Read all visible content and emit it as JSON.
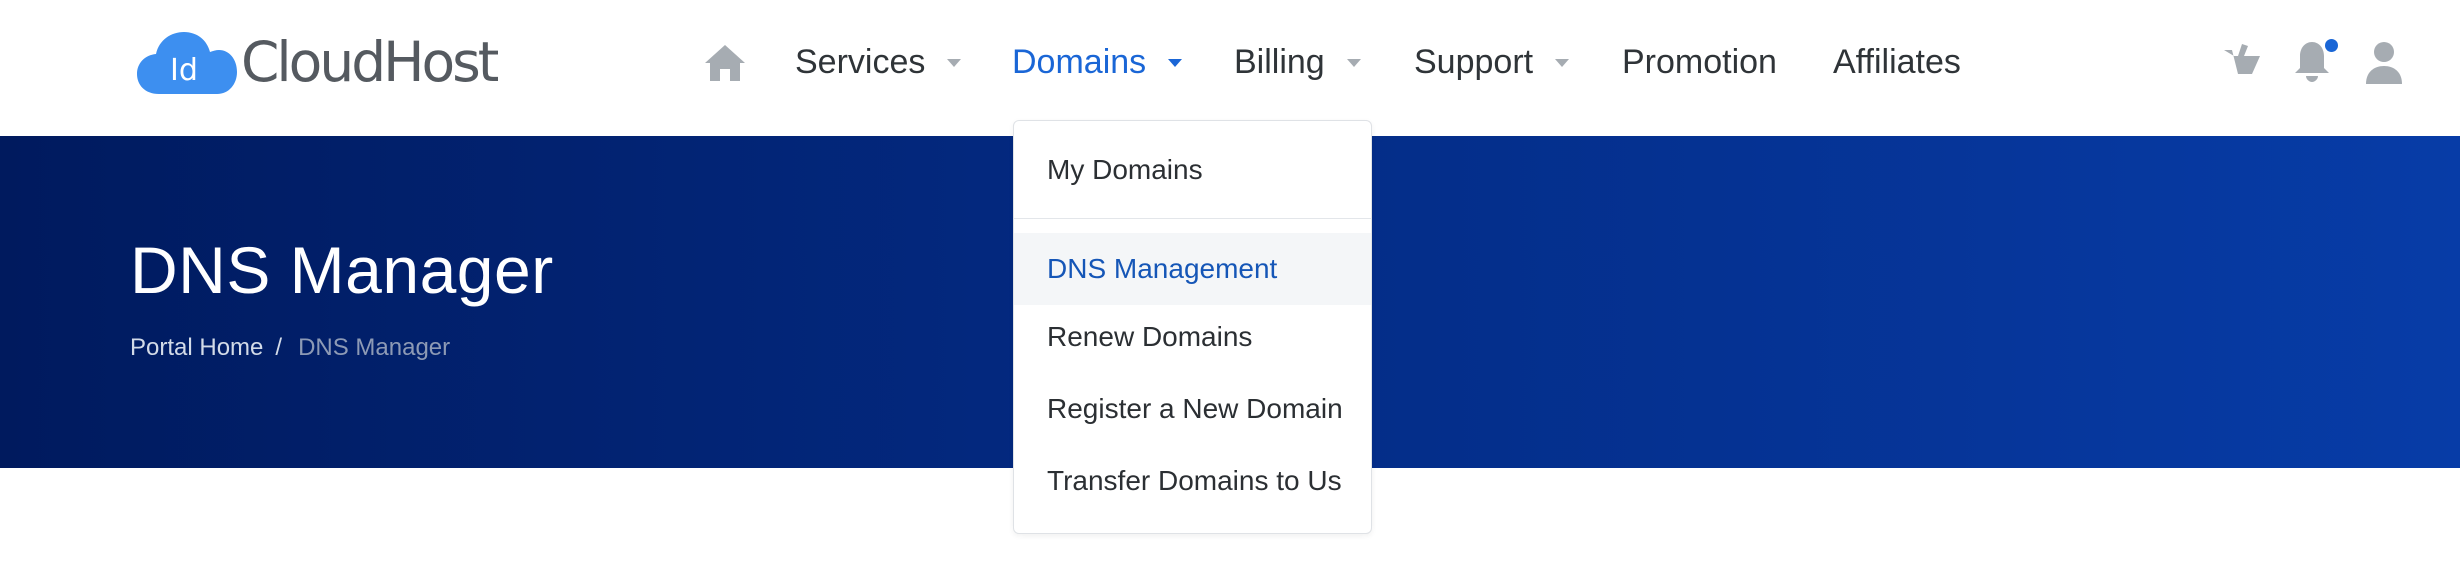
{
  "brand": {
    "logo_mark": "Id",
    "name": "CloudHost"
  },
  "nav": {
    "home_icon": "home-icon",
    "items": [
      {
        "label": "Services",
        "has_dropdown": true,
        "active": false
      },
      {
        "label": "Domains",
        "has_dropdown": true,
        "active": true
      },
      {
        "label": "Billing",
        "has_dropdown": true,
        "active": false
      },
      {
        "label": "Support",
        "has_dropdown": true,
        "active": false
      },
      {
        "label": "Promotion",
        "has_dropdown": false,
        "active": false
      },
      {
        "label": "Affiliates",
        "has_dropdown": false,
        "active": false
      }
    ],
    "right_icons": [
      "cart-icon",
      "bell-icon",
      "user-icon"
    ]
  },
  "domains_menu": {
    "items": [
      {
        "label": "My Domains",
        "highlighted": false
      },
      {
        "label": "DNS Management",
        "highlighted": true
      },
      {
        "label": "Renew Domains",
        "highlighted": false
      },
      {
        "label": "Register a New Domain",
        "highlighted": false
      },
      {
        "label": "Transfer Domains to Us",
        "highlighted": false
      }
    ]
  },
  "hero": {
    "title": "DNS Manager",
    "breadcrumb": {
      "home": "Portal Home",
      "separator": "/",
      "current": "DNS Manager"
    }
  },
  "colors": {
    "accent": "#1a66d6",
    "hero_start": "#001a5e",
    "hero_end": "#073ca7",
    "logo_blue": "#3d8ff0",
    "icon_gray": "#a6acb2"
  }
}
